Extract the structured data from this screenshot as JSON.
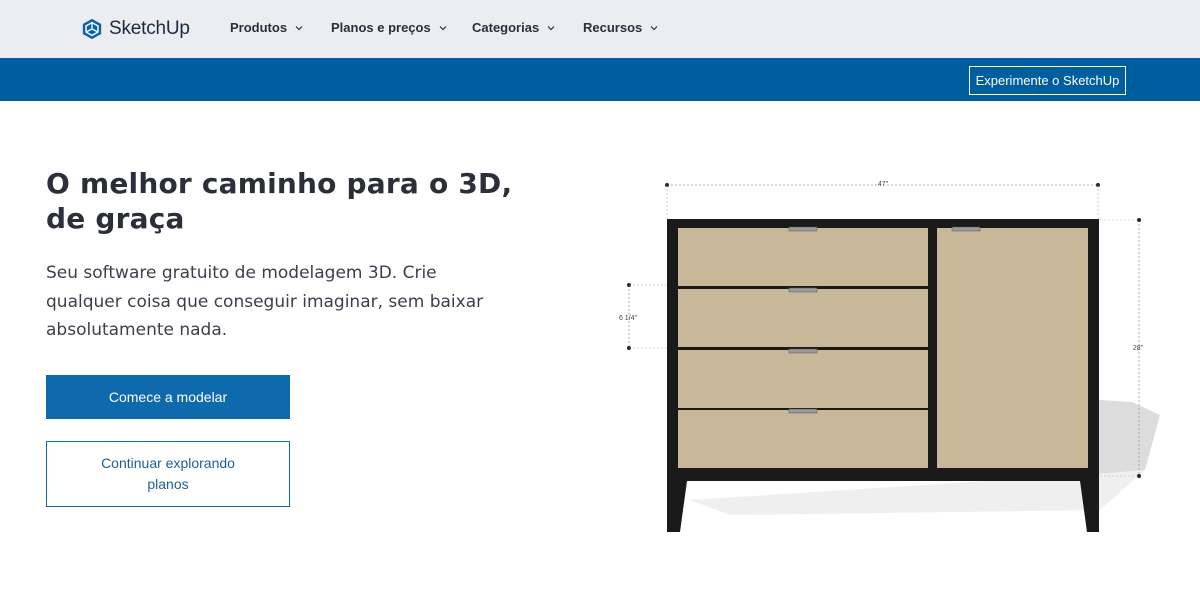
{
  "header": {
    "brand": "SketchUp",
    "nav": [
      {
        "label": "Produtos"
      },
      {
        "label": "Planos e preços"
      },
      {
        "label": "Categorias"
      },
      {
        "label": "Recursos"
      }
    ],
    "cta_label": "Experimente o SketchUp"
  },
  "hero": {
    "title_line1": "O melhor caminho para o 3D,",
    "title_line2": "de graça",
    "subtitle": "Seu software gratuito de modelagem 3D. Crie qualquer coisa que conseguir imaginar, sem baixar absolutamente nada.",
    "primary_button": "Comece a modelar",
    "secondary_button": "Continuar explorando planos"
  },
  "illustration": {
    "dim_width": "47\"",
    "dim_height": "28\"",
    "dim_drawer": "6 1/4\""
  },
  "colors": {
    "brand_blue": "#005e9e",
    "button_blue": "#0f69ad",
    "nav_bg": "#ecedf1",
    "panel_tan": "#c8b899",
    "cabinet_frame": "#1a1a1a"
  },
  "icons": [
    "sketchup-logo-icon",
    "chevron-down-icon"
  ]
}
